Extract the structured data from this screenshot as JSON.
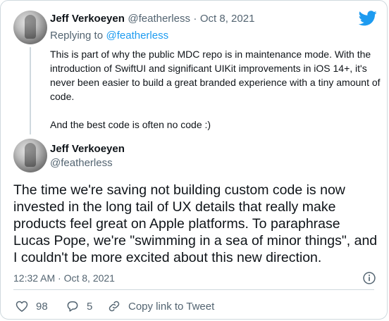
{
  "brand_color": "#1d9bf0",
  "parent_tweet": {
    "author_name": "Jeff Verkoeyen",
    "handle": "@featherless",
    "separator": "·",
    "date": "Oct 8, 2021",
    "replying_label": "Replying to",
    "replying_handle": "@featherless",
    "paragraph1": "This is part of why the public MDC repo is in maintenance mode. With the introduction of SwiftUI and significant UIKit improvements in iOS 14+, it's never been easier to build a great branded experience with a tiny amount of code.",
    "paragraph2": "And the best code is often no code :)"
  },
  "main_tweet": {
    "author_name": "Jeff Verkoeyen",
    "handle": "@featherless",
    "text": "The time we're saving not building custom code is now invested in the long tail of UX details that really make products feel great on Apple platforms. To paraphrase Lucas Pope, we're \"swimming in a sea of minor things\", and I couldn't be more excited about this new direction.",
    "timestamp": "12:32 AM · Oct 8, 2021"
  },
  "actions": {
    "like_count": "98",
    "reply_count": "5",
    "copy_link_label": "Copy link to Tweet"
  },
  "icons": [
    "twitter-bird-icon",
    "info-icon",
    "heart-icon",
    "reply-bubble-icon",
    "link-icon"
  ]
}
